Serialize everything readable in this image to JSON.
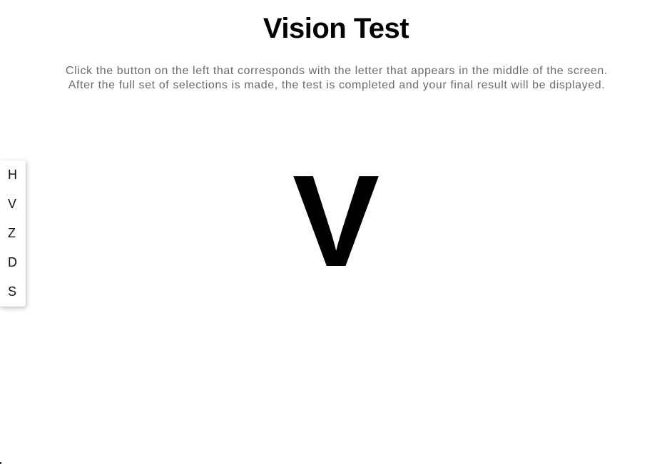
{
  "page": {
    "title": "Vision Test",
    "instructions": "Click the button on the left that corresponds with the letter that appears in the middle of the screen. After the full set of selections is made, the test is completed and your final result will be displayed."
  },
  "letter_menu": {
    "items": [
      {
        "label": "H"
      },
      {
        "label": "V"
      },
      {
        "label": "Z"
      },
      {
        "label": "D"
      },
      {
        "label": "S"
      }
    ]
  },
  "display": {
    "current_letter": "V"
  }
}
